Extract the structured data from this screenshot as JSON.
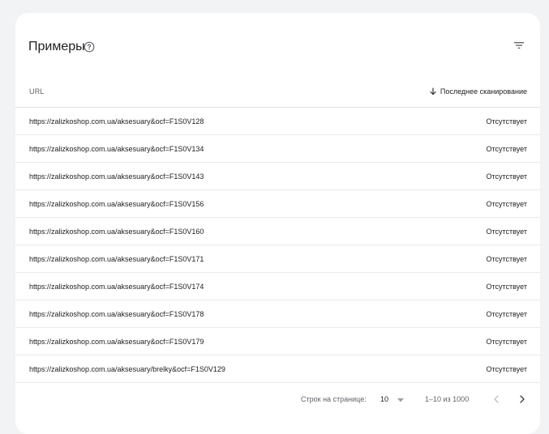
{
  "card": {
    "title": "Примеры",
    "help_icon": "help-circle-icon",
    "filter_icon": "filter-list-icon"
  },
  "table": {
    "columns": {
      "url": "URL",
      "last_crawl": "Последнее сканирование",
      "sort_icon": "arrow-down-icon"
    },
    "rows": [
      {
        "url": "https://zalizkoshop.com.ua/aksesuary&ocf=F1S0V128",
        "status": "Отсутствует"
      },
      {
        "url": "https://zalizkoshop.com.ua/aksesuary&ocf=F1S0V134",
        "status": "Отсутствует"
      },
      {
        "url": "https://zalizkoshop.com.ua/aksesuary&ocf=F1S0V143",
        "status": "Отсутствует"
      },
      {
        "url": "https://zalizkoshop.com.ua/aksesuary&ocf=F1S0V156",
        "status": "Отсутствует"
      },
      {
        "url": "https://zalizkoshop.com.ua/aksesuary&ocf=F1S0V160",
        "status": "Отсутствует"
      },
      {
        "url": "https://zalizkoshop.com.ua/aksesuary&ocf=F1S0V171",
        "status": "Отсутствует"
      },
      {
        "url": "https://zalizkoshop.com.ua/aksesuary&ocf=F1S0V174",
        "status": "Отсутствует"
      },
      {
        "url": "https://zalizkoshop.com.ua/aksesuary&ocf=F1S0V178",
        "status": "Отсутствует"
      },
      {
        "url": "https://zalizkoshop.com.ua/aksesuary&ocf=F1S0V179",
        "status": "Отсутствует"
      },
      {
        "url": "https://zalizkoshop.com.ua/aksesuary/brelky&ocf=F1S0V129",
        "status": "Отсутствует"
      }
    ]
  },
  "pagination": {
    "rows_per_page_label": "Строк на странице:",
    "rows_per_page_value": "10",
    "range_text": "1–10 из 1000",
    "prev_icon": "chevron-left-icon",
    "next_icon": "chevron-right-icon"
  },
  "colors": {
    "background": "#f1f3f4",
    "card": "#ffffff",
    "divider": "#e8eaed",
    "muted_text": "#5f6368",
    "text": "#202124"
  }
}
